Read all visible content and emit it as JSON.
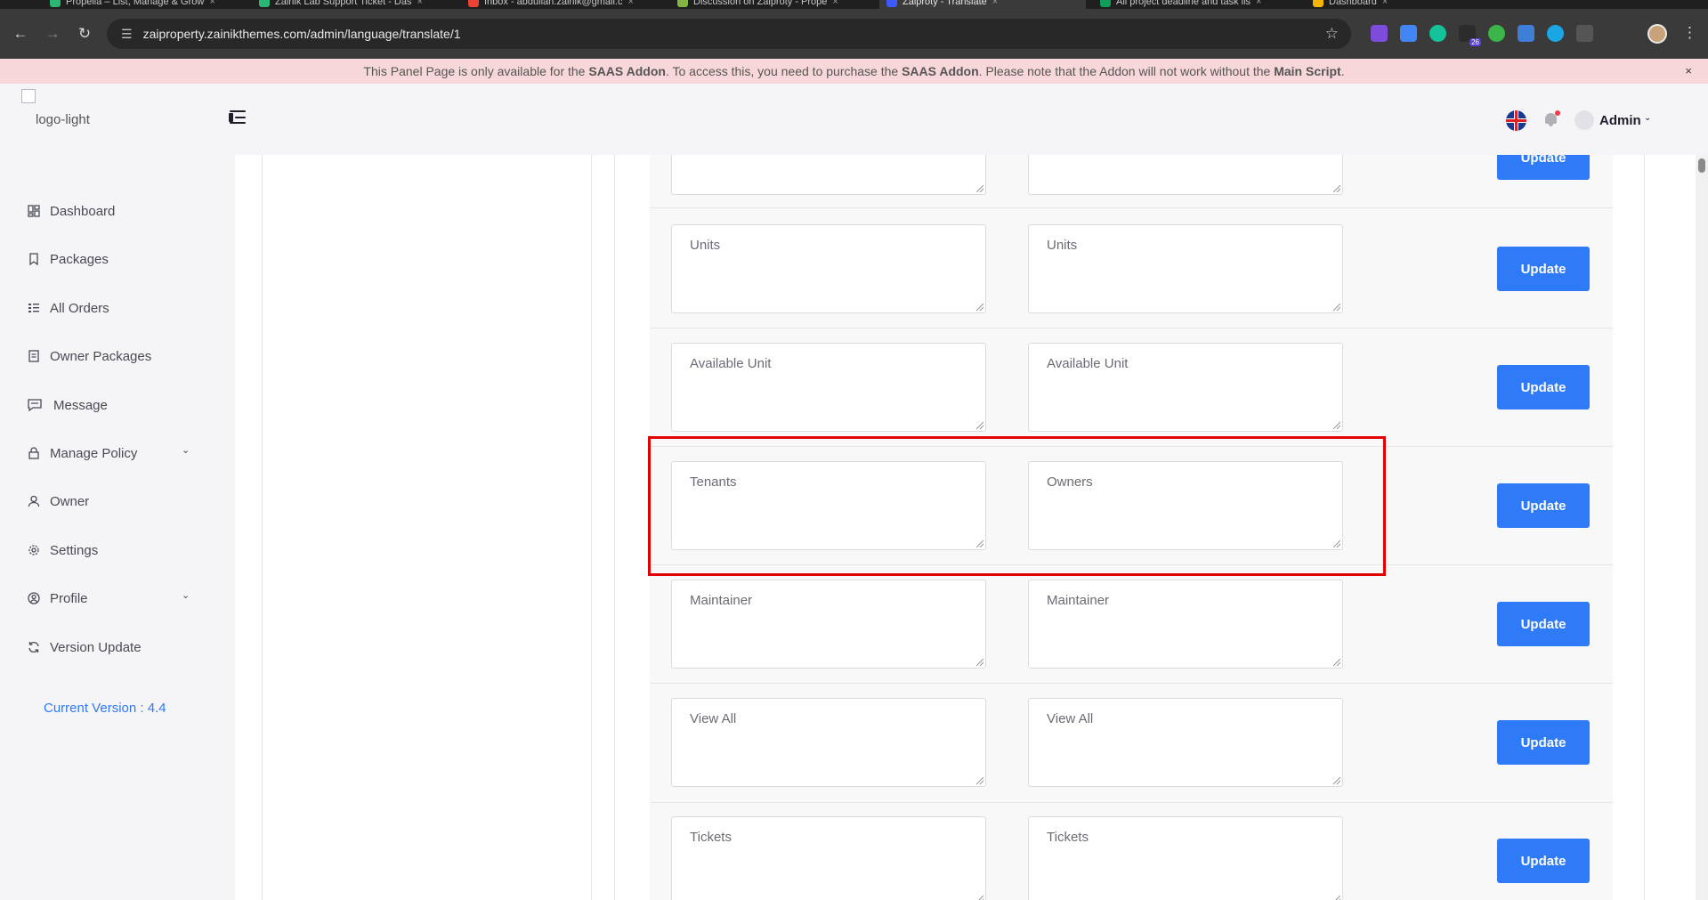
{
  "browser": {
    "tabs": [
      {
        "title": "Propella – List, Manage & Grow",
        "color": "#2bb673"
      },
      {
        "title": "Zainik Lab Support Ticket - Das",
        "color": "#2bb673"
      },
      {
        "title": "Inbox - abdullah.zainik@gmail.c",
        "color": "#ea4335"
      },
      {
        "title": "Discussion on Zaiproty - Prope",
        "color": "#82b541"
      },
      {
        "title": "Zaiproty - Translate",
        "color": "#3d5afe"
      },
      {
        "title": "All project deadline and task lis",
        "color": "#0f9d58"
      },
      {
        "title": "Dashboard",
        "color": "#f4b400"
      }
    ],
    "url": "zaiproperty.zainikthemes.com/admin/language/translate/1",
    "extension_badge": "26"
  },
  "notice": {
    "prefix": "This Panel Page is only available for the ",
    "addon1": "SAAS Addon",
    "mid1": ". To access this, you need to purchase the ",
    "addon2": "SAAS Addon",
    "mid2": ". Please note that the Addon will not work without the ",
    "script": "Main Script",
    "suffix": ".",
    "close": "×"
  },
  "header": {
    "logo_alt": "logo-light",
    "user_name": "Admin",
    "caret": "⌄"
  },
  "sidebar": {
    "items": [
      {
        "label": "Dashboard",
        "icon": "dashboard-icon"
      },
      {
        "label": "Packages",
        "icon": "bookmark-icon"
      },
      {
        "label": "All Orders",
        "icon": "list-icon"
      },
      {
        "label": "Owner Packages",
        "icon": "document-icon"
      },
      {
        "label": "Message",
        "icon": "chat-icon"
      },
      {
        "label": "Manage Policy",
        "icon": "lock-icon"
      },
      {
        "label": "Owner",
        "icon": "user-icon"
      },
      {
        "label": "Settings",
        "icon": "gear-icon"
      },
      {
        "label": "Profile",
        "icon": "user-circle-icon"
      },
      {
        "label": "Version Update",
        "icon": "refresh-icon"
      }
    ],
    "current_version": "Current Version : 4.4"
  },
  "translations": {
    "update_label": "Update",
    "rows": [
      {
        "key": "",
        "value": ""
      },
      {
        "key": "Units",
        "value": "Units"
      },
      {
        "key": "Available Unit",
        "value": "Available Unit"
      },
      {
        "key": "Tenants",
        "value": "Owners"
      },
      {
        "key": "Maintainer",
        "value": "Maintainer"
      },
      {
        "key": "View All",
        "value": "View All"
      },
      {
        "key": "Tickets",
        "value": "Tickets"
      }
    ]
  },
  "colors": {
    "accent": "#2f7af6",
    "notice_bg": "#f8d7da",
    "highlight": "#e00000"
  }
}
